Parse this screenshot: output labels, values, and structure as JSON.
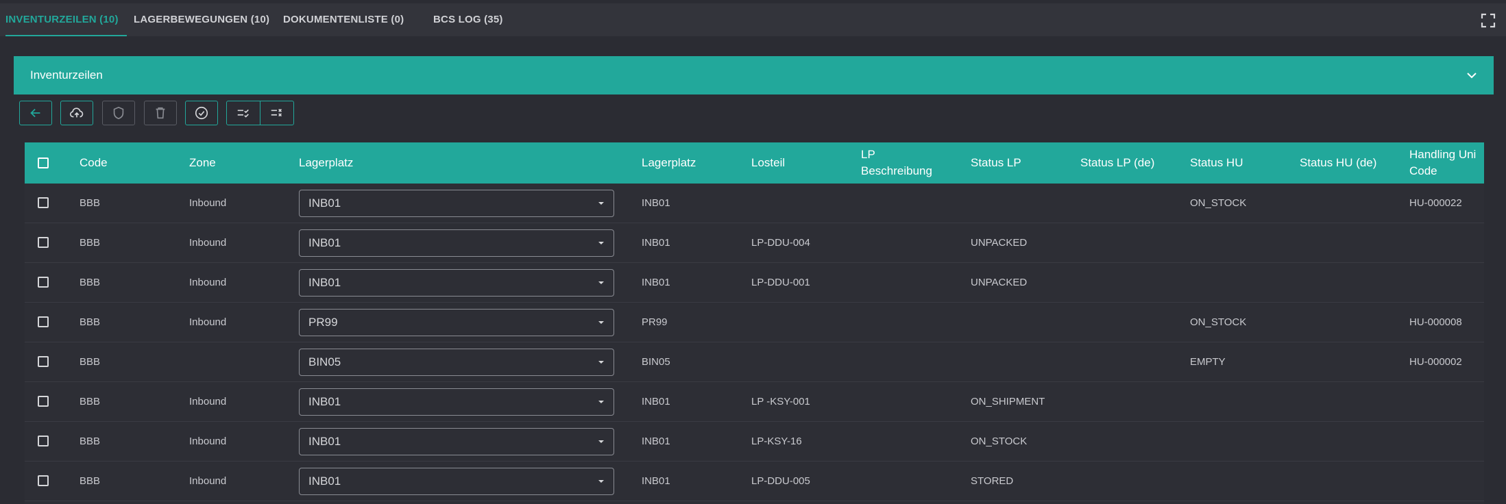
{
  "tabs": [
    {
      "label": "INVENTURZEILEN (10)",
      "active": true
    },
    {
      "label": "LAGERBEWEGUNGEN (10)",
      "active": false
    },
    {
      "label": "DOKUMENTENLISTE (0)",
      "active": false
    },
    {
      "label": "BCS LOG (35)",
      "active": false
    }
  ],
  "section": {
    "title": "Inventurzeilen"
  },
  "toolbar": {
    "buttons": [
      {
        "icon": "arrow-left-icon",
        "enabled": true
      },
      {
        "icon": "cloud-upload-icon",
        "enabled": true
      },
      {
        "icon": "shield-icon",
        "enabled": false
      },
      {
        "icon": "trash-icon",
        "enabled": false
      },
      {
        "icon": "check-circle-icon",
        "enabled": true
      },
      {
        "icon": "list-check-icon",
        "enabled": true
      },
      {
        "icon": "list-remove-icon",
        "enabled": true
      }
    ]
  },
  "table": {
    "headers": {
      "code": "Code",
      "zone": "Zone",
      "lagerplatz_select": "Lagerplatz",
      "lagerplatz": "Lagerplatz",
      "losteil": "Losteil",
      "lp_beschreibung_1": "LP",
      "lp_beschreibung_2": "Beschreibung",
      "status_lp": "Status LP",
      "status_lp_de": "Status LP (de)",
      "status_hu": "Status HU",
      "status_hu_de": "Status HU (de)",
      "hu_code_1": "Handling Uni",
      "hu_code_2": "Code"
    },
    "rows": [
      {
        "code": "BBB",
        "zone": "Inbound",
        "select": "INB01",
        "lagerplatz": "INB01",
        "losteil": "",
        "lp_beschreibung": "",
        "status_lp": "",
        "status_lp_de": "",
        "status_hu": "ON_STOCK",
        "status_hu_de": "",
        "hu_code": "HU-000022"
      },
      {
        "code": "BBB",
        "zone": "Inbound",
        "select": "INB01",
        "lagerplatz": "INB01",
        "losteil": "LP-DDU-004",
        "lp_beschreibung": "",
        "status_lp": "UNPACKED",
        "status_lp_de": "",
        "status_hu": "",
        "status_hu_de": "",
        "hu_code": ""
      },
      {
        "code": "BBB",
        "zone": "Inbound",
        "select": "INB01",
        "lagerplatz": "INB01",
        "losteil": "LP-DDU-001",
        "lp_beschreibung": "",
        "status_lp": "UNPACKED",
        "status_lp_de": "",
        "status_hu": "",
        "status_hu_de": "",
        "hu_code": ""
      },
      {
        "code": "BBB",
        "zone": "Inbound",
        "select": "PR99",
        "lagerplatz": "PR99",
        "losteil": "",
        "lp_beschreibung": "",
        "status_lp": "",
        "status_lp_de": "",
        "status_hu": "ON_STOCK",
        "status_hu_de": "",
        "hu_code": "HU-000008"
      },
      {
        "code": "BBB",
        "zone": "",
        "select": "BIN05",
        "lagerplatz": "BIN05",
        "losteil": "",
        "lp_beschreibung": "",
        "status_lp": "",
        "status_lp_de": "",
        "status_hu": "EMPTY",
        "status_hu_de": "",
        "hu_code": "HU-000002"
      },
      {
        "code": "BBB",
        "zone": "Inbound",
        "select": "INB01",
        "lagerplatz": "INB01",
        "losteil": "LP -KSY-001",
        "lp_beschreibung": "",
        "status_lp": "ON_SHIPMENT",
        "status_lp_de": "",
        "status_hu": "",
        "status_hu_de": "",
        "hu_code": ""
      },
      {
        "code": "BBB",
        "zone": "Inbound",
        "select": "INB01",
        "lagerplatz": "INB01",
        "losteil": "LP-KSY-16",
        "lp_beschreibung": "",
        "status_lp": "ON_STOCK",
        "status_lp_de": "",
        "status_hu": "",
        "status_hu_de": "",
        "hu_code": ""
      },
      {
        "code": "BBB",
        "zone": "Inbound",
        "select": "INB01",
        "lagerplatz": "INB01",
        "losteil": "LP-DDU-005",
        "lp_beschreibung": "",
        "status_lp": "STORED",
        "status_lp_de": "",
        "status_hu": "",
        "status_hu_de": "",
        "hu_code": ""
      }
    ]
  },
  "colors": {
    "accent": "#22a89b",
    "background": "#2b2c33",
    "tabbar": "#33343b"
  }
}
